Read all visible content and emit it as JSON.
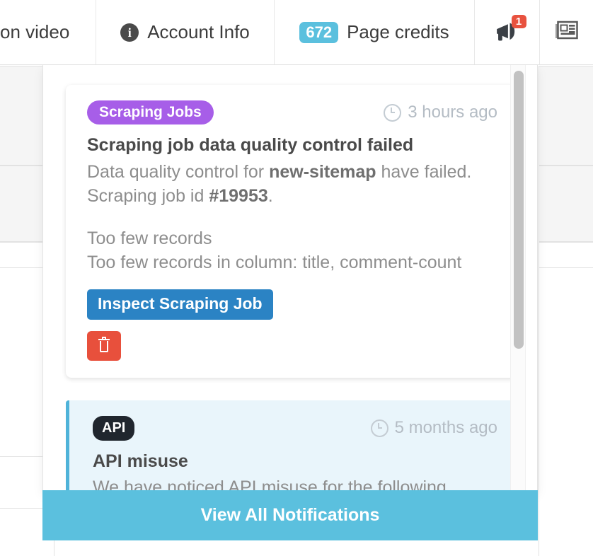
{
  "navbar": {
    "items": [
      {
        "label": "on video",
        "icon": "",
        "truncated": true
      },
      {
        "label": "Account Info",
        "icon": "info-circle-icon"
      },
      {
        "label": "Page credits",
        "icon": "",
        "badge": "672"
      }
    ],
    "megaphone": {
      "icon": "megaphone-icon",
      "badge": "1"
    },
    "news": {
      "icon": "newspaper-icon"
    }
  },
  "dropdown": {
    "notifications": [
      {
        "tag": "Scraping Jobs",
        "tag_color": "#a75ee8",
        "timestamp": "3 hours ago",
        "title": "Scraping job data quality control failed",
        "body_line1_pre": "Data quality control for ",
        "body_line1_strong": "new-sitemap",
        "body_line1_post": " have failed.",
        "body_line2_pre": "Scraping job id ",
        "body_line2_strong": "#19953",
        "body_line2_post": ".",
        "detail_line1": "Too few records",
        "detail_line2": "Too few records in column: title, comment-count",
        "primary_button": "Inspect Scraping Job",
        "delete_button": "delete"
      },
      {
        "tag": "API",
        "tag_color": "#20262e",
        "timestamp": "5 months ago",
        "title": "API misuse",
        "body_line1_pre": "We have noticed API misuse for the following",
        "body_line1_strong": "",
        "body_line1_post": ""
      }
    ],
    "view_all_label": "View All Notifications",
    "view_all_color": "#5bc0de",
    "scrollbar": {
      "position": "top"
    }
  }
}
